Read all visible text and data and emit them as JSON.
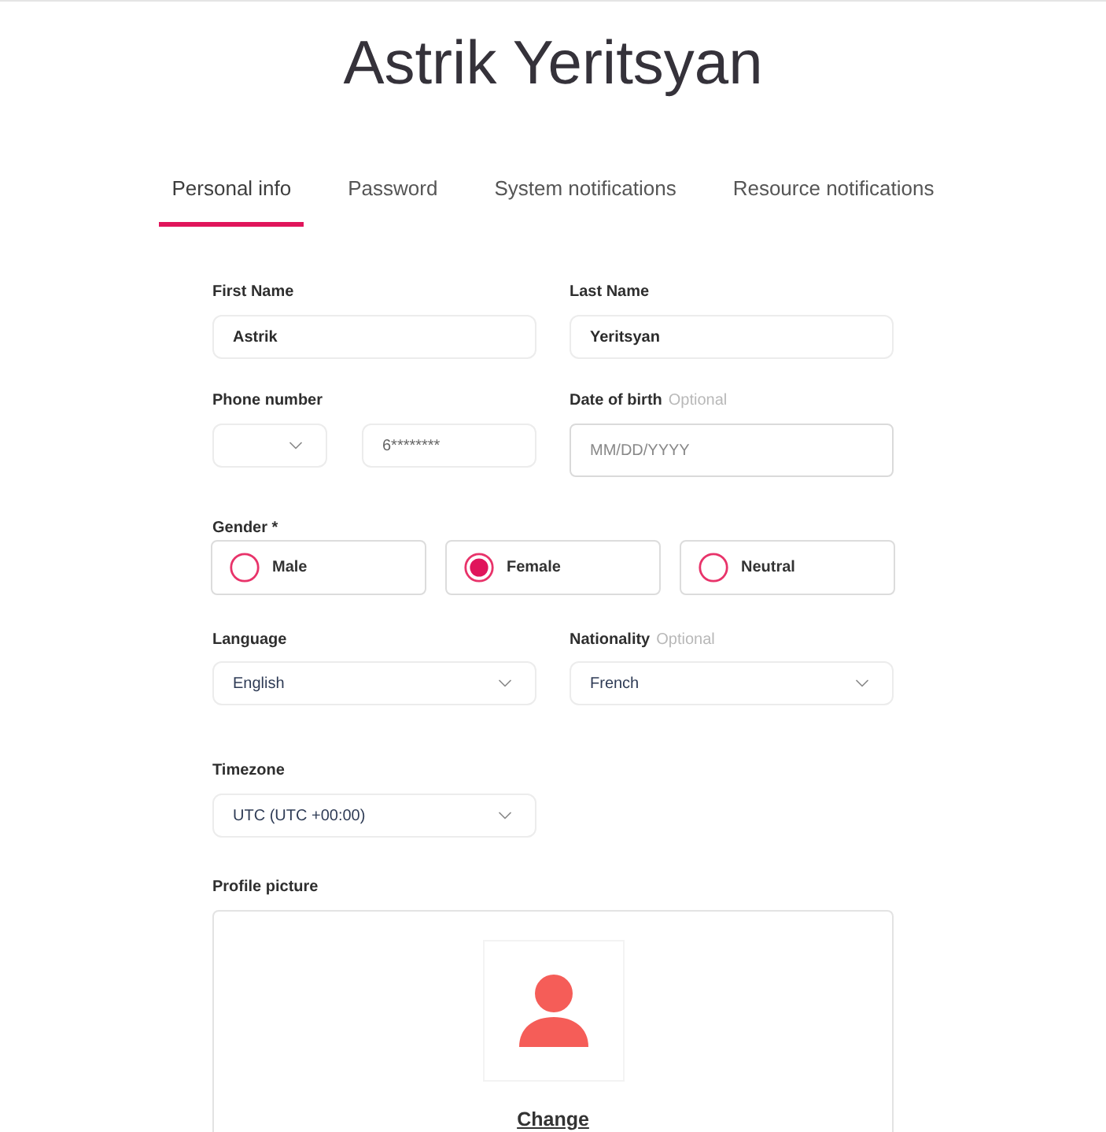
{
  "title": "Astrik Yeritsyan",
  "tabs": [
    {
      "label": "Personal info",
      "selected": true
    },
    {
      "label": "Password",
      "selected": false
    },
    {
      "label": "System notifications",
      "selected": false
    },
    {
      "label": "Resource notifications",
      "selected": false
    }
  ],
  "form": {
    "first_name": {
      "label": "First Name",
      "value": "Astrik"
    },
    "last_name": {
      "label": "Last Name",
      "value": "Yeritsyan"
    },
    "phone": {
      "label": "Phone number",
      "value": "6********"
    },
    "date_of_birth": {
      "label": "Date of birth",
      "hint": "Optional",
      "placeholder": "MM/DD/YYYY"
    },
    "gender": {
      "label": "Gender *",
      "options": [
        {
          "label": "Male",
          "selected": false
        },
        {
          "label": "Female",
          "selected": true
        },
        {
          "label": "Neutral",
          "selected": false
        }
      ]
    },
    "language": {
      "label": "Language",
      "value": "English"
    },
    "nationality": {
      "label": "Nationality",
      "hint": "Optional",
      "value": "French"
    },
    "timezone": {
      "label": "Timezone",
      "value": "UTC (UTC +00:00)"
    },
    "profile_picture": {
      "label": "Profile picture",
      "action": "Change"
    }
  }
}
